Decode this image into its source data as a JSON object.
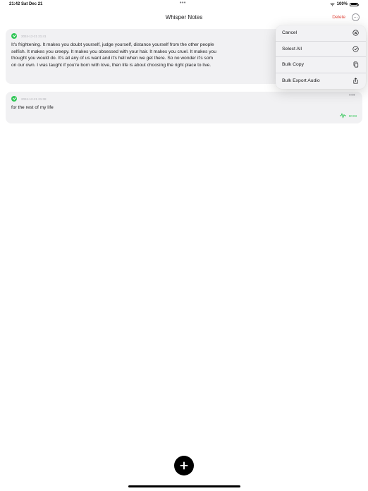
{
  "status_bar": {
    "time": "21:42  Sat Dec 21",
    "dots": "•••",
    "battery": "100%"
  },
  "nav": {
    "title": "Whisper Notes",
    "delete_label": "Delete"
  },
  "notes": [
    {
      "date": "2024-12-21 21:41",
      "text": "It's frightening. It makes you doubt yourself, judge yourself, distance yourself from the other people\nselfish. It makes you creepy. It makes you obsessed with your hair. It makes you cruel. It makes you\nthought you would do. It's all any of us want and it's hell when we get there. So no wonder it's som\non our own. I was taught if you're born with love, then life is about choosing the right place to live."
    },
    {
      "date": "2024-12-21 21:38",
      "text": "for the rest of my life",
      "more": "•••",
      "duration": "00:03"
    }
  ],
  "menu": {
    "items": [
      {
        "label": "Cancel",
        "icon": "cancel-circle-icon"
      },
      {
        "label": "Select All",
        "icon": "checkmark-circle-icon"
      },
      {
        "label": "Bulk Copy",
        "icon": "copy-icon"
      },
      {
        "label": "Bulk Export Audio",
        "icon": "share-icon"
      }
    ]
  },
  "colors": {
    "accent_green": "#34c759",
    "delete_red": "#e0453a",
    "card_bg": "#f1f1f3"
  }
}
